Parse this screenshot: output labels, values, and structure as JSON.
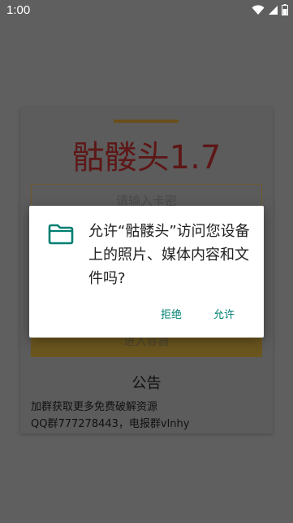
{
  "status_bar": {
    "time": "1:00",
    "icons": [
      "wifi-icon",
      "signal-icon",
      "battery-icon"
    ]
  },
  "card": {
    "title": "骷髅头1.7",
    "input_placeholder": "请输入卡密",
    "button_label": "进入容器",
    "notice_heading": "公告",
    "notice_lines": [
      "加群获取更多免费破解资源",
      "QQ群777278443，电报群vlnhy"
    ]
  },
  "dialog": {
    "icon": "folder-icon",
    "message": "允许“骷髅头”访问您设备上的照片、媒体内容和文件吗?",
    "deny_label": "拒绝",
    "allow_label": "允许"
  },
  "colors": {
    "scrim": "#5f5f5f",
    "accent": "#007f72",
    "title": "#8b0000",
    "button": "#d4a017"
  }
}
